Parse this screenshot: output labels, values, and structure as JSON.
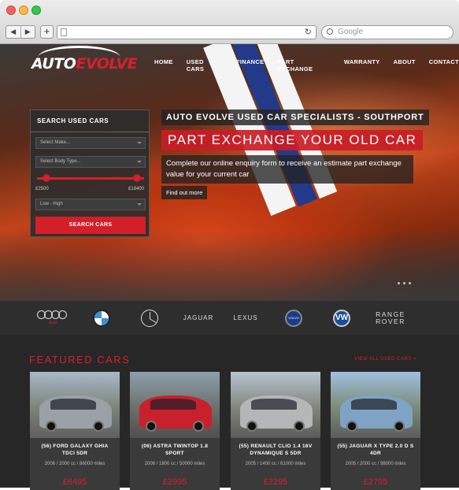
{
  "browser": {
    "search_placeholder": "Google",
    "nav_back": "◀",
    "nav_forward": "▶",
    "new_tab": "+",
    "reload": "↻"
  },
  "site": {
    "logo_part1": "AUTO",
    "logo_part2": "EVOLVE"
  },
  "nav": {
    "items": [
      "HOME",
      "USED CARS",
      "FINANCE",
      "PART EXCHANGE",
      "WARRANTY",
      "ABOUT",
      "CONTACT"
    ]
  },
  "search_panel": {
    "title": "SEARCH USED CARS",
    "make_placeholder": "Select Make...",
    "body_placeholder": "Select Body Type...",
    "price_min": "£2500",
    "price_max": "£18400",
    "sort": "Low - High",
    "button": "SEARCH CARS"
  },
  "banner": {
    "subtitle": "AUTO EVOLVE USED CAR SPECIALISTS - SOUTHPORT",
    "headline": "PART EXCHANGE YOUR OLD CAR",
    "description": "Complete our online enquiry form to receive an estimate part exchange value for your current car",
    "cta": "Find out more"
  },
  "brands": {
    "audi": "Audi",
    "jaguar": "JAGUAR",
    "lexus": "LEXUS",
    "volvo": "VOLVO",
    "vw": "VW",
    "rr_line1": "RANGE",
    "rr_line2": "ROVER"
  },
  "featured": {
    "title": "FEATURED CARS",
    "view_all": "VIEW ALL USED CARS >",
    "cars": [
      {
        "name": "(56) FORD GALAXY GHIA TDCI 5DR",
        "specs": "2006 / 2000 cc / 86000 miles",
        "price": "£6495",
        "color": "#9aa0a6"
      },
      {
        "name": "(06) ASTRA TWINTOP 1.8 SPORT",
        "specs": "2006 / 1800 cc / 50000 miles",
        "price": "£2995",
        "color": "#c8202c"
      },
      {
        "name": "(55) RENAULT CLIO 1.4 16V DYNAMIQUE S 5DR",
        "specs": "2005 / 1400 cc / 61000 miles",
        "price": "£2295",
        "color": "#b4b6b8"
      },
      {
        "name": "(55) JAGUAR X TYPE 2.0 D S 4DR",
        "specs": "2005 / 2000 cc / 98000 miles",
        "price": "£2795",
        "color": "#7fa3c4"
      }
    ]
  },
  "colors": {
    "accent": "#d7202a",
    "dark_bg": "#272727",
    "brand_bar": "#2e2e2e"
  }
}
